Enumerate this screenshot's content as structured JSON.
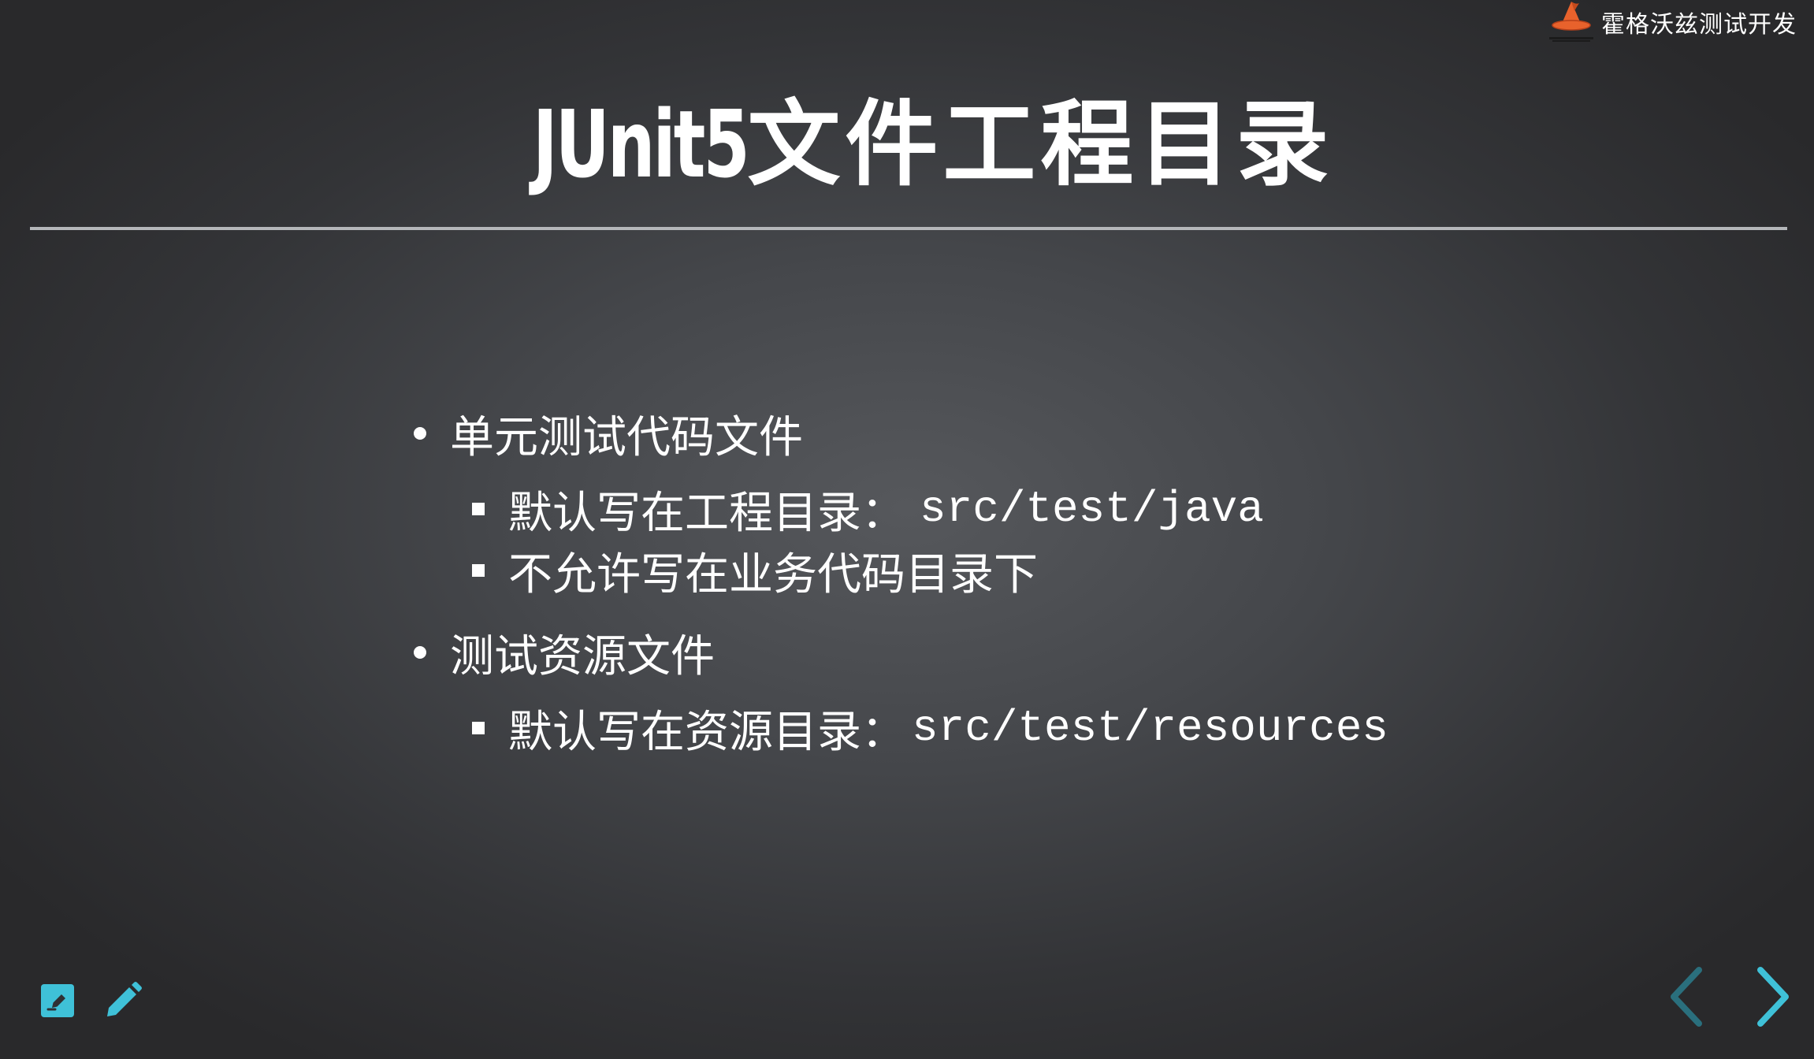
{
  "brand": {
    "name": "霍格沃兹测试开发",
    "logo_icon": "wizard-hat-logo-icon"
  },
  "slide": {
    "title_latin": "JUnit5",
    "title_cjk": "文件工程目录",
    "bullets": [
      {
        "text": "单元测试代码文件",
        "subs": [
          {
            "text": "默认写在工程目录：",
            "code": "src/test/java"
          },
          {
            "text": "不允许写在业务代码目录下",
            "code": ""
          }
        ]
      },
      {
        "text": "测试资源文件",
        "subs": [
          {
            "text": "默认写在资源目录：",
            "code": "src/test/resources"
          }
        ]
      }
    ]
  },
  "toolbar": {
    "edit_icon": "edit-note-icon",
    "pencil_icon": "pencil-icon"
  },
  "navigation": {
    "prev_icon": "chevron-left-icon",
    "next_icon": "chevron-right-icon"
  },
  "colors": {
    "accent": "#3fc1d8",
    "accent_dim": "#2a6f7d",
    "background_center": "#56585c",
    "background_edge": "#29292b",
    "logo_orange": "#e8622c"
  }
}
